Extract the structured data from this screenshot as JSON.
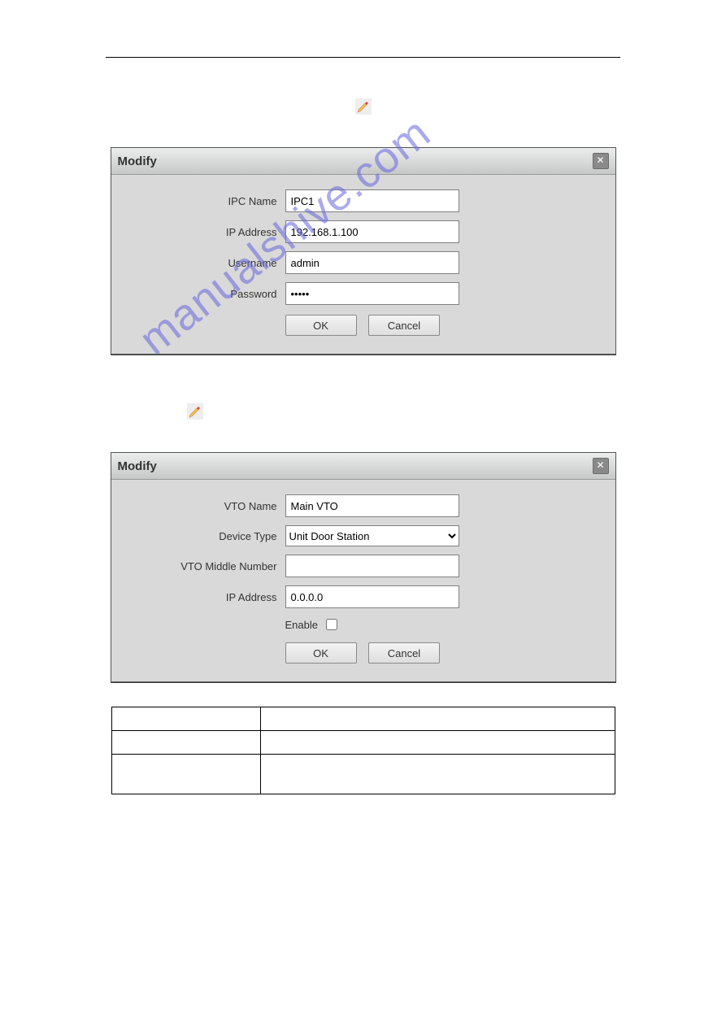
{
  "watermark_text": "manualshive.com",
  "dialog1": {
    "title": "Modify",
    "labels": {
      "ipc_name": "IPC Name",
      "ip_address": "IP Address",
      "username": "Username",
      "password": "Password"
    },
    "values": {
      "ipc_name": "IPC1",
      "ip_address": "192.168.1.100",
      "username": "admin",
      "password": "•••••"
    },
    "buttons": {
      "ok": "OK",
      "cancel": "Cancel"
    }
  },
  "dialog2": {
    "title": "Modify",
    "labels": {
      "vto_name": "VTO Name",
      "device_type": "Device Type",
      "vto_middle_number": "VTO Middle Number",
      "ip_address": "IP Address",
      "enable": "Enable"
    },
    "values": {
      "vto_name": "Main VTO",
      "device_type": "Unit Door Station",
      "vto_middle_number": "",
      "ip_address": "0.0.0.0",
      "enable": false
    },
    "buttons": {
      "ok": "OK",
      "cancel": "Cancel"
    }
  }
}
